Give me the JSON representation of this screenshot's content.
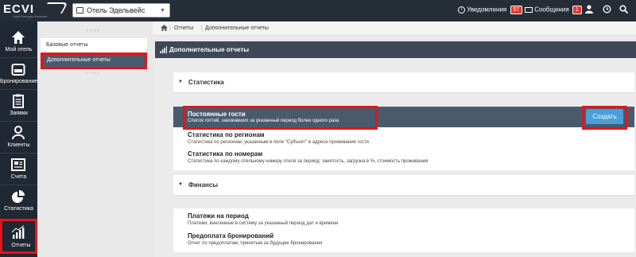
{
  "app": {
    "logo_text": "ECVI",
    "logo_subtitle": "Hotel Manager Assistant"
  },
  "topbar": {
    "hotel_select_value": "Отель Эдельвейс",
    "notifications_label": "Уведомления",
    "notifications_count": "57",
    "messages_label": "Сообщения",
    "messages_count": "1",
    "icons": [
      "bell-icon",
      "mail-icon",
      "user-icon",
      "history-icon",
      "search-icon"
    ]
  },
  "leftnav": {
    "items": [
      {
        "label": "Мой отель",
        "icon": "home-icon"
      },
      {
        "label": "Бронирование",
        "icon": "bed-icon"
      },
      {
        "label": "Заявки",
        "icon": "clipboard-icon"
      },
      {
        "label": "Клиенты",
        "icon": "person-icon"
      },
      {
        "label": "Счета",
        "icon": "invoice-icon"
      },
      {
        "label": "Статистика",
        "icon": "pie-chart-icon"
      },
      {
        "label": "Отчеты",
        "icon": "bar-chart-icon",
        "active": true
      }
    ]
  },
  "submenu": {
    "items": [
      {
        "label": "Базовые отчеты"
      },
      {
        "label": "Дополнительные отчеты",
        "selected": true
      }
    ]
  },
  "breadcrumb": {
    "items": [
      "Отчеты",
      "Дополнительные отчеты"
    ]
  },
  "panel": {
    "title": "Дополнительные отчеты",
    "sections": [
      {
        "title": "Статистика",
        "reports": [
          {
            "title": "Постоянные гости",
            "desc": "Список гостей, заезжавших за указанный период более одного раза",
            "highlighted": true
          },
          {
            "title": "Статистика по регионам",
            "desc": "Статистика по регионам, указанным в поле \"Субъект\" в адресе проживания гостя"
          },
          {
            "title": "Статистика по номерам",
            "desc": "Статистика по каждому отельному номеру отеля за период: занятость, загрузка в %, стоимость проживания"
          }
        ]
      },
      {
        "title": "Финансы",
        "reports": [
          {
            "title": "Платежи на период",
            "desc": "Платежи, внесенные в систему за указанный период дат и времени"
          },
          {
            "title": "Предоплата бронирований",
            "desc": "Отчет по предоплатам, принятым за будущие бронирования"
          }
        ]
      }
    ],
    "create_button": "Создать"
  },
  "colors": {
    "topbar": "#252d37",
    "leftnav": "#1f2833",
    "highlight": "#4a5a6d",
    "accent_red": "#e3151a",
    "button_blue": "#4a9fd8",
    "badge_red": "#e03a2e"
  }
}
